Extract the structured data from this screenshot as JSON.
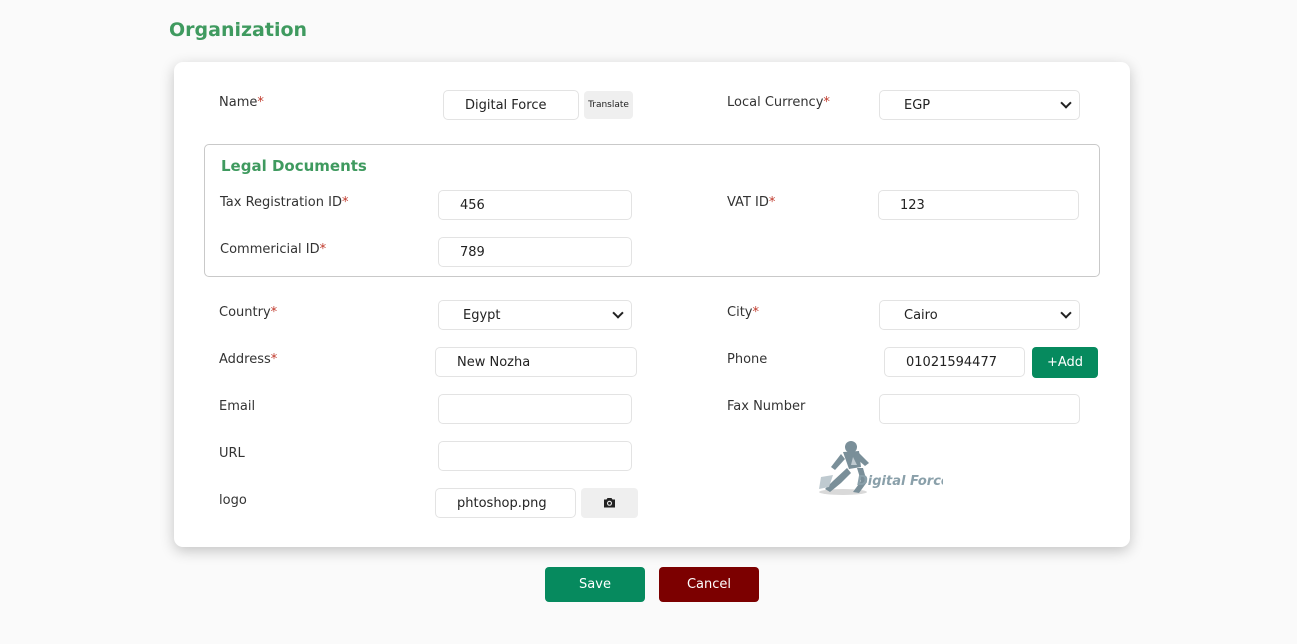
{
  "page": {
    "title": "Organization"
  },
  "form": {
    "name": {
      "label": "Name",
      "value": "Digital Force",
      "translate_label": "Translate"
    },
    "local_currency": {
      "label": "Local Currency",
      "value": "EGP"
    },
    "legal": {
      "title": "Legal Documents",
      "tax_registration": {
        "label": "Tax Registration ID",
        "value": "456"
      },
      "vat": {
        "label": "VAT ID",
        "value": "123"
      },
      "commercial": {
        "label": "Commericial ID",
        "value": "789"
      }
    },
    "country": {
      "label": "Country",
      "value": "Egypt"
    },
    "city": {
      "label": "City",
      "value": "Cairo"
    },
    "address": {
      "label": "Address",
      "value": "New Nozha"
    },
    "phone": {
      "label": "Phone",
      "value": "01021594477",
      "add_label": "+Add"
    },
    "email": {
      "label": "Email",
      "value": ""
    },
    "fax": {
      "label": "Fax Number",
      "value": ""
    },
    "url": {
      "label": "URL",
      "value": ""
    },
    "logo": {
      "label": "logo",
      "value": "phtoshop.png",
      "brand_text": "Digital Force"
    }
  },
  "required_mark": "*",
  "actions": {
    "save_label": "Save",
    "cancel_label": "Cancel"
  },
  "icons": {
    "upload": "camera-icon",
    "dropdown": "chevron-down-icon"
  },
  "colors": {
    "accent": "#3f9a5f",
    "primary": "#068a5e",
    "danger": "#7c0000",
    "required": "#c0392b"
  }
}
